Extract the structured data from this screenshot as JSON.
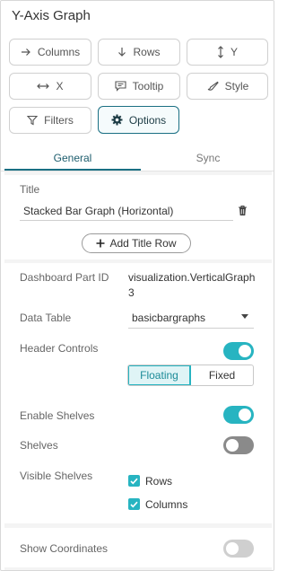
{
  "panel": {
    "title": "Y-Axis Graph"
  },
  "toolbar": {
    "columns": {
      "label": "Columns",
      "icon": "arrow-right-icon"
    },
    "rows": {
      "label": "Rows",
      "icon": "arrow-down-icon"
    },
    "y": {
      "label": "Y",
      "icon": "vertical-arrows-icon"
    },
    "x": {
      "label": "X",
      "icon": "horizontal-arrows-icon"
    },
    "tooltip": {
      "label": "Tooltip",
      "icon": "tooltip-icon"
    },
    "style": {
      "label": "Style",
      "icon": "paint-brush-icon"
    },
    "filters": {
      "label": "Filters",
      "icon": "funnel-icon"
    },
    "options": {
      "label": "Options",
      "icon": "gear-icon",
      "active": true
    }
  },
  "tabs": [
    {
      "label": "General",
      "active": true
    },
    {
      "label": "Sync",
      "active": false
    }
  ],
  "general": {
    "title_label": "Title",
    "title_value": "Stacked Bar Graph (Horizontal)",
    "add_title_row": "Add Title Row",
    "dashboard_part_id_label": "Dashboard Part ID",
    "dashboard_part_id_line1": "visualization.VerticalGraph",
    "dashboard_part_id_line2": "3",
    "data_table_label": "Data Table",
    "data_table_value": "basicbargraphs",
    "header_controls_label": "Header Controls",
    "header_controls_on": true,
    "header_mode_options": [
      "Floating",
      "Fixed"
    ],
    "header_mode_selected": "Floating",
    "enable_shelves_label": "Enable Shelves",
    "enable_shelves_on": true,
    "shelves_label": "Shelves",
    "shelves_on": false,
    "visible_shelves_label": "Visible Shelves",
    "visible_shelves": [
      {
        "label": "Rows",
        "checked": true
      },
      {
        "label": "Columns",
        "checked": true
      }
    ],
    "show_coordinates_label": "Show Coordinates",
    "show_coordinates_on": false
  },
  "colors": {
    "accent": "#27b4c1",
    "tab_accent": "#1a6f83",
    "toggle_off": "#8a8a8a"
  }
}
